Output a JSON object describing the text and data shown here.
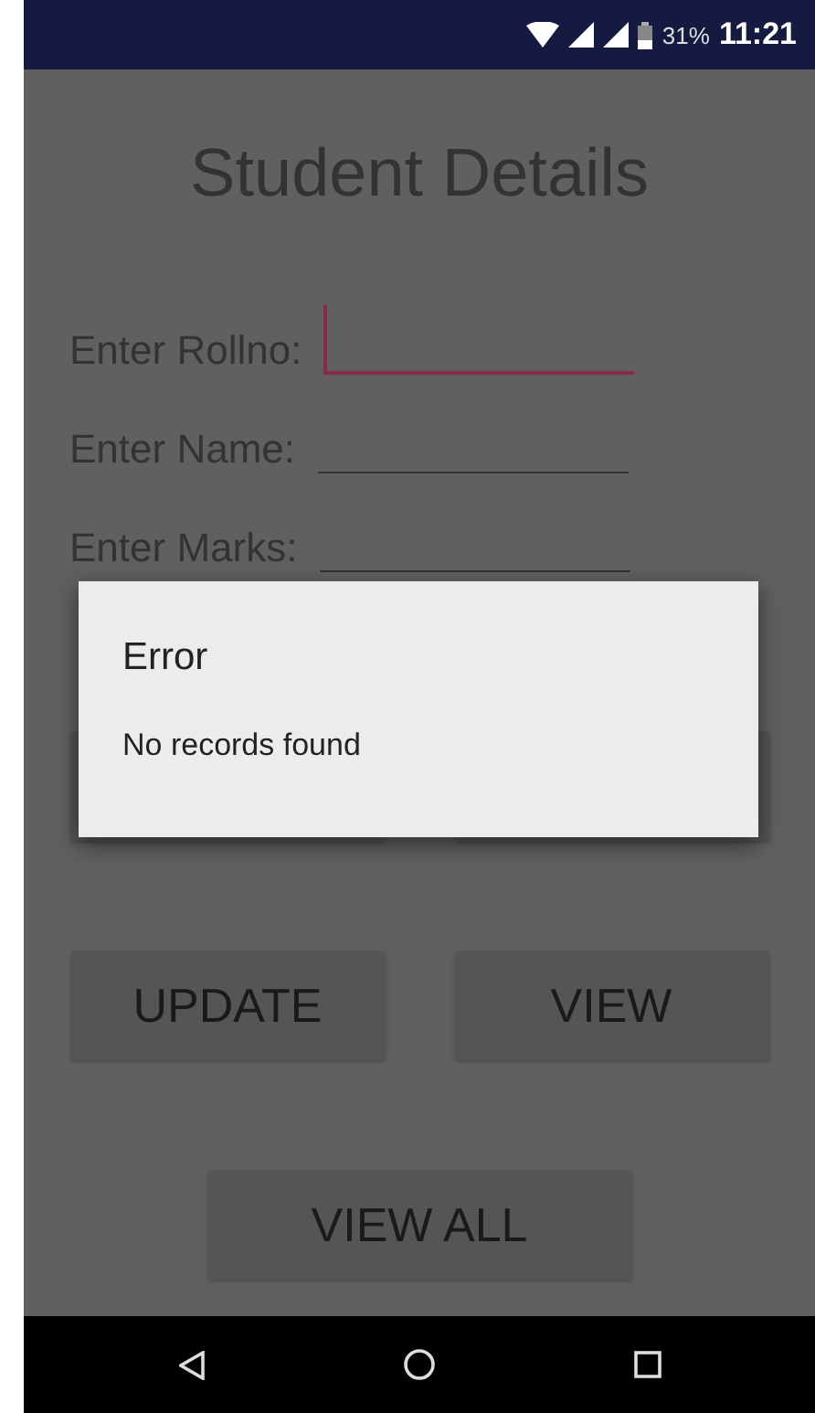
{
  "status_bar": {
    "battery": "31%",
    "time": "11:21"
  },
  "title": "Student Details",
  "fields": [
    {
      "label": "Enter Rollno:",
      "focused": true
    },
    {
      "label": "Enter Name:",
      "focused": false
    },
    {
      "label": "Enter Marks:",
      "focused": false
    }
  ],
  "button_rows": [
    {
      "buttons": [
        "UPDATE",
        "VIEW"
      ]
    },
    {
      "buttons": [
        "VIEW ALL"
      ]
    }
  ],
  "dialog": {
    "title": "Error",
    "message": "No records found"
  }
}
